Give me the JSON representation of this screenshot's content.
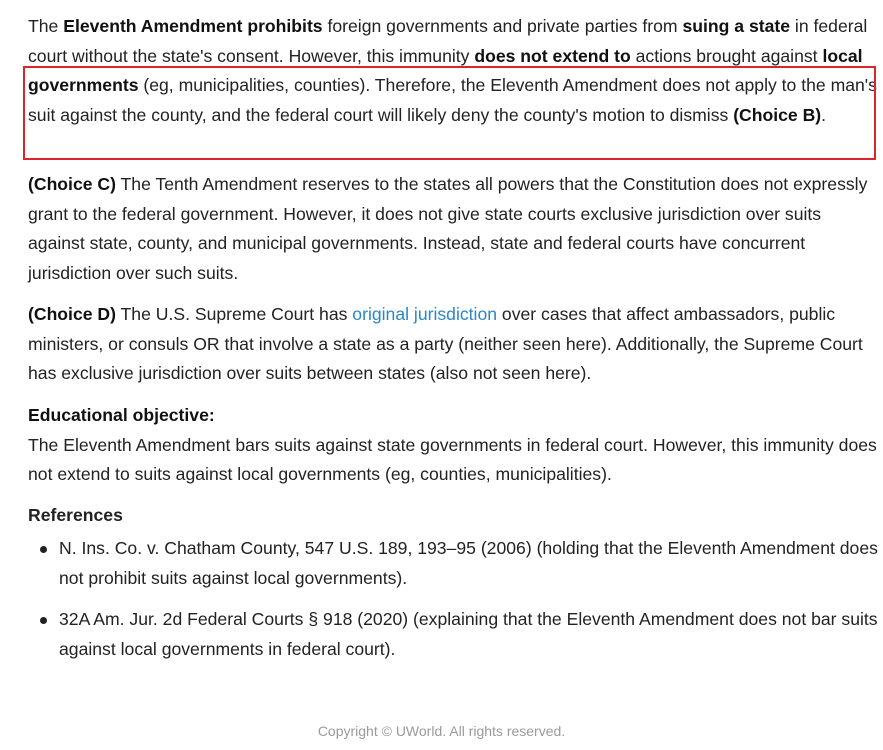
{
  "explanation": {
    "p1": {
      "t1": "The ",
      "b1": "Eleventh Amendment prohibits",
      "t2": " foreign governments and private parties from ",
      "b2": "suing a state",
      "t3": " in federal court without the state's consent.  However, this immunity ",
      "b3": "does not extend to",
      "t4": " actions brought against ",
      "b4": "local governments",
      "t5": " (eg, municipalities, counties).  Therefore, the Eleventh Amendment does not apply to the man's suit against the county, and the federal court will likely deny the county's motion to dismiss ",
      "b5": "(Choice B)",
      "t6": "."
    },
    "choice_c": {
      "label": "(Choice C)",
      "text": "  The Tenth Amendment reserves to the states all powers that the Constitution does not expressly grant to the federal government.  However, it does not give state courts exclusive jurisdiction over suits against state, county, and municipal governments.  Instead, state and federal courts have concurrent jurisdiction over such suits."
    },
    "choice_d": {
      "label": "(Choice D)",
      "t1": "  The U.S. Supreme Court has ",
      "link": "original jurisdiction",
      "t2": " over cases that affect ambassadors, public ministers, or consuls OR that involve a state as a party (neither seen here).  Additionally, the Supreme Court has exclusive jurisdiction over suits between states (also not seen here)."
    },
    "objective": {
      "heading": "Educational objective:",
      "text": "The Eleventh Amendment bars suits against state governments in federal court.  However, this immunity does not extend to suits against local governments (eg, counties, municipalities)."
    },
    "references": {
      "heading": "References",
      "items": [
        "N. Ins. Co. v. Chatham County, 547 U.S. 189, 193–95 (2006) (holding that the Eleventh Amendment does not prohibit suits against local governments).",
        "32A Am. Jur. 2d Federal Courts § 918 (2020) (explaining that the Eleventh Amendment does not bar suits against local governments in federal court)."
      ]
    }
  },
  "footer": "Copyright © UWorld. All rights reserved.",
  "colors": {
    "highlight_border": "#d9262b",
    "link": "#2a86c8"
  }
}
